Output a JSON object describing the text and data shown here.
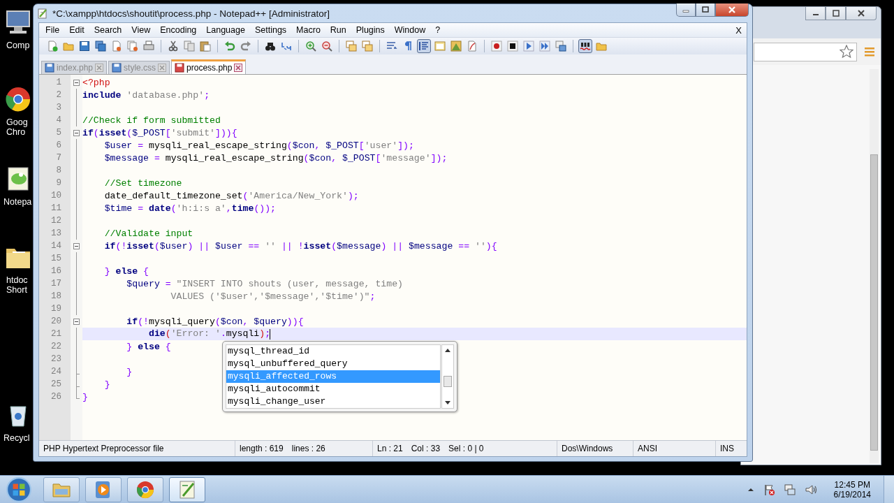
{
  "desktop": {
    "icons": [
      {
        "kind": "computer",
        "label": [
          "Comp"
        ]
      },
      {
        "kind": "chrome",
        "label": [
          "Goog",
          "Chro"
        ]
      },
      {
        "kind": "notepad",
        "label": [
          "Notepa"
        ]
      },
      {
        "kind": "folder",
        "label": [
          "htdoc",
          "Short"
        ]
      },
      {
        "kind": "recycle",
        "label": [
          "Recycl"
        ]
      }
    ]
  },
  "window": {
    "title": "*C:\\xampp\\htdocs\\shoutit\\process.php - Notepad++ [Administrator]"
  },
  "menu": [
    "File",
    "Edit",
    "Search",
    "View",
    "Encoding",
    "Language",
    "Settings",
    "Macro",
    "Run",
    "Plugins",
    "Window",
    "?"
  ],
  "menu_close": "X",
  "toolbar": [
    [
      {
        "kind": "new",
        "pressed": false
      },
      {
        "kind": "open",
        "pressed": false
      },
      {
        "kind": "save",
        "pressed": false
      },
      {
        "kind": "saveall",
        "pressed": false
      },
      {
        "kind": "close",
        "pressed": false
      },
      {
        "kind": "closeall",
        "pressed": false
      },
      {
        "kind": "print",
        "pressed": false
      }
    ],
    [
      {
        "kind": "cut",
        "pressed": false
      },
      {
        "kind": "copy",
        "pressed": false
      },
      {
        "kind": "paste",
        "pressed": false
      }
    ],
    [
      {
        "kind": "undo",
        "pressed": false
      },
      {
        "kind": "redo",
        "pressed": false
      }
    ],
    [
      {
        "kind": "find",
        "pressed": false
      },
      {
        "kind": "replace",
        "pressed": false
      }
    ],
    [
      {
        "kind": "zoomin",
        "pressed": false
      },
      {
        "kind": "zoomout",
        "pressed": false
      }
    ],
    [
      {
        "kind": "sync",
        "pressed": false
      },
      {
        "kind": "sync",
        "pressed": false
      }
    ],
    [
      {
        "kind": "wrap",
        "pressed": false
      },
      {
        "kind": "paragraph",
        "pressed": false
      },
      {
        "kind": "indent",
        "pressed": true
      },
      {
        "kind": "panel",
        "pressed": false
      },
      {
        "kind": "image",
        "pressed": false
      },
      {
        "kind": "doc",
        "pressed": false
      }
    ],
    [
      {
        "kind": "record",
        "pressed": false
      },
      {
        "kind": "stop",
        "pressed": false
      },
      {
        "kind": "play",
        "pressed": false
      },
      {
        "kind": "playmulti",
        "pressed": false
      },
      {
        "kind": "savemacro",
        "pressed": false
      }
    ],
    [
      {
        "kind": "spell",
        "pressed": true
      },
      {
        "kind": "open",
        "pressed": false
      }
    ]
  ],
  "tabs": [
    {
      "label": "index.php",
      "selected": false,
      "modified": false
    },
    {
      "label": "style.css",
      "selected": false,
      "modified": false
    },
    {
      "label": "process.php",
      "selected": true,
      "modified": true
    }
  ],
  "lines": [
    {
      "number": "1",
      "kind": "start",
      "current": false,
      "tokens": [
        {
          "kind": "tag",
          "text": "<?php"
        }
      ]
    },
    {
      "number": "2",
      "kind": "body",
      "current": false,
      "tokens": [
        {
          "kind": "kw",
          "text": "include"
        },
        {
          "kind": "str",
          "text": " 'database.php'"
        },
        {
          "kind": "op",
          "text": ";"
        }
      ]
    },
    {
      "number": "3",
      "kind": "body",
      "current": false
    },
    {
      "number": "4",
      "kind": "body",
      "current": false,
      "tokens": [
        {
          "kind": "cmt",
          "text": "//Check if form submitted"
        }
      ]
    },
    {
      "number": "5",
      "kind": "start",
      "current": false,
      "tokens": [
        {
          "kind": "kw",
          "text": "if"
        },
        {
          "kind": "op",
          "text": "("
        },
        {
          "kind": "kw",
          "text": "isset"
        },
        {
          "kind": "op",
          "text": "("
        },
        {
          "kind": "var",
          "text": "$_POST"
        },
        {
          "kind": "op",
          "text": "["
        },
        {
          "kind": "str",
          "text": "'submit'"
        },
        {
          "kind": "op",
          "text": "])){"
        }
      ]
    },
    {
      "number": "6",
      "kind": "body",
      "current": false,
      "tokens": [
        {
          "kind": "var",
          "text": "    $user"
        },
        {
          "kind": "op",
          "text": " = "
        },
        {
          "kind": "fn",
          "text": "mysqli_real_escape_string"
        },
        {
          "kind": "op",
          "text": "("
        },
        {
          "kind": "var",
          "text": "$con"
        },
        {
          "kind": "op",
          "text": ", "
        },
        {
          "kind": "var",
          "text": "$_POST"
        },
        {
          "kind": "op",
          "text": "["
        },
        {
          "kind": "str",
          "text": "'user'"
        },
        {
          "kind": "op",
          "text": "]);"
        }
      ]
    },
    {
      "number": "7",
      "kind": "body",
      "current": false,
      "tokens": [
        {
          "kind": "var",
          "text": "    $message"
        },
        {
          "kind": "op",
          "text": " = "
        },
        {
          "kind": "fn",
          "text": "mysqli_real_escape_string"
        },
        {
          "kind": "op",
          "text": "("
        },
        {
          "kind": "var",
          "text": "$con"
        },
        {
          "kind": "op",
          "text": ", "
        },
        {
          "kind": "var",
          "text": "$_POST"
        },
        {
          "kind": "op",
          "text": "["
        },
        {
          "kind": "str",
          "text": "'message'"
        },
        {
          "kind": "op",
          "text": "]);"
        }
      ]
    },
    {
      "number": "8",
      "kind": "body",
      "current": false
    },
    {
      "number": "9",
      "kind": "body",
      "current": false,
      "tokens": [
        {
          "kind": "cmt",
          "text": "    //Set timezone"
        }
      ]
    },
    {
      "number": "10",
      "kind": "body",
      "current": false,
      "tokens": [
        {
          "kind": "fn",
          "text": "    date_default_timezone_set"
        },
        {
          "kind": "op",
          "text": "("
        },
        {
          "kind": "str",
          "text": "'America/New_York'"
        },
        {
          "kind": "op",
          "text": ");"
        }
      ]
    },
    {
      "number": "11",
      "kind": "body",
      "current": false,
      "tokens": [
        {
          "kind": "var",
          "text": "    $time"
        },
        {
          "kind": "op",
          "text": " = "
        },
        {
          "kind": "kw",
          "text": "date"
        },
        {
          "kind": "op",
          "text": "("
        },
        {
          "kind": "str",
          "text": "'h:i:s a'"
        },
        {
          "kind": "op",
          "text": ","
        },
        {
          "kind": "kw",
          "text": "time"
        },
        {
          "kind": "op",
          "text": "());"
        }
      ]
    },
    {
      "number": "12",
      "kind": "body",
      "current": false
    },
    {
      "number": "13",
      "kind": "body",
      "current": false,
      "tokens": [
        {
          "kind": "cmt",
          "text": "    //Validate input"
        }
      ]
    },
    {
      "number": "14",
      "kind": "start",
      "current": false,
      "tokens": [
        {
          "kind": "kw",
          "text": "    if"
        },
        {
          "kind": "op",
          "text": "(!"
        },
        {
          "kind": "kw",
          "text": "isset"
        },
        {
          "kind": "op",
          "text": "("
        },
        {
          "kind": "var",
          "text": "$user"
        },
        {
          "kind": "op",
          "text": ") || "
        },
        {
          "kind": "var",
          "text": "$user"
        },
        {
          "kind": "op",
          "text": " == "
        },
        {
          "kind": "str",
          "text": "''"
        },
        {
          "kind": "op",
          "text": " || !"
        },
        {
          "kind": "kw",
          "text": "isset"
        },
        {
          "kind": "op",
          "text": "("
        },
        {
          "kind": "var",
          "text": "$message"
        },
        {
          "kind": "op",
          "text": ") || "
        },
        {
          "kind": "var",
          "text": "$message"
        },
        {
          "kind": "op",
          "text": " == "
        },
        {
          "kind": "str",
          "text": "''"
        },
        {
          "kind": "op",
          "text": "){"
        }
      ]
    },
    {
      "number": "15",
      "kind": "body",
      "current": false
    },
    {
      "number": "16",
      "kind": "body",
      "current": false,
      "tokens": [
        {
          "kind": "op",
          "text": "    } "
        },
        {
          "kind": "kw",
          "text": "else"
        },
        {
          "kind": "op",
          "text": " {"
        }
      ]
    },
    {
      "number": "17",
      "kind": "body",
      "current": false,
      "tokens": [
        {
          "kind": "var",
          "text": "        $query"
        },
        {
          "kind": "op",
          "text": " = "
        },
        {
          "kind": "str",
          "text": "\"INSERT INTO shouts (user, message, time)"
        }
      ]
    },
    {
      "number": "18",
      "kind": "body",
      "current": false,
      "tokens": [
        {
          "kind": "str",
          "text": "                VALUES ('$user','$message','$time')\""
        },
        {
          "kind": "op",
          "text": ";"
        }
      ]
    },
    {
      "number": "19",
      "kind": "body",
      "current": false
    },
    {
      "number": "20",
      "kind": "start",
      "current": false,
      "tokens": [
        {
          "kind": "kw",
          "text": "        if"
        },
        {
          "kind": "op",
          "text": "(!"
        },
        {
          "kind": "fn",
          "text": "mysqli_query"
        },
        {
          "kind": "op",
          "text": "("
        },
        {
          "kind": "var",
          "text": "$con"
        },
        {
          "kind": "op",
          "text": ", "
        },
        {
          "kind": "var",
          "text": "$query"
        },
        {
          "kind": "op",
          "text": ")){"
        }
      ]
    },
    {
      "number": "21",
      "kind": "body",
      "current": true,
      "tokens": [
        {
          "kind": "kw",
          "text": "            die"
        },
        {
          "kind": "tag",
          "text": "("
        },
        {
          "kind": "str",
          "text": "'Error: '"
        },
        {
          "kind": "op",
          "text": "."
        },
        {
          "kind": "fn",
          "text": "mysqli"
        },
        {
          "kind": "tag",
          "text": ")"
        },
        {
          "kind": "op",
          "text": ";"
        }
      ]
    },
    {
      "number": "22",
      "kind": "body",
      "current": false,
      "tokens": [
        {
          "kind": "op",
          "text": "        } "
        },
        {
          "kind": "kw",
          "text": "else"
        },
        {
          "kind": "op",
          "text": " {"
        }
      ]
    },
    {
      "number": "23",
      "kind": "body",
      "current": false
    },
    {
      "number": "24",
      "kind": "end",
      "current": false,
      "tokens": [
        {
          "kind": "op",
          "text": "        }"
        }
      ]
    },
    {
      "number": "25",
      "kind": "end",
      "current": false,
      "tokens": [
        {
          "kind": "op",
          "text": "    }"
        }
      ]
    },
    {
      "number": "26",
      "kind": "close",
      "current": false,
      "tokens": [
        {
          "kind": "op",
          "text": "}"
        }
      ]
    }
  ],
  "autocomplete": [
    {
      "label": "mysql_thread_id",
      "selected": false
    },
    {
      "label": "mysql_unbuffered_query",
      "selected": false
    },
    {
      "label": "mysqli_affected_rows",
      "selected": true
    },
    {
      "label": "mysqli_autocommit",
      "selected": false
    },
    {
      "label": "mysqli_change_user",
      "selected": false
    }
  ],
  "status_bar": [
    {
      "texts": [
        "PHP Hypertext Preprocessor file"
      ]
    },
    {
      "texts": [
        "length : 619",
        "lines : 26"
      ]
    },
    {
      "texts": [
        "Ln : 21",
        "Col : 33",
        "Sel : 0 | 0"
      ]
    },
    {
      "texts": [
        "Dos\\Windows"
      ]
    },
    {
      "texts": [
        "ANSI"
      ]
    },
    {
      "texts": [
        "INS"
      ]
    }
  ],
  "taskbar": {
    "buttons": [
      {
        "kind": "folder",
        "selected": false
      },
      {
        "kind": "media",
        "selected": false
      },
      {
        "kind": "chrome",
        "selected": false
      },
      {
        "kind": "notepad",
        "selected": true
      }
    ],
    "time": "12:45 PM",
    "date": "6/19/2014"
  }
}
